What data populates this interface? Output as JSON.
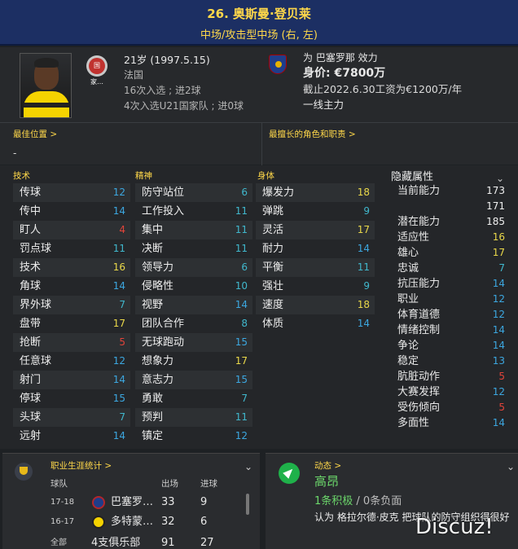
{
  "header": {
    "name": "26. 奥斯曼·登贝莱",
    "position": "中场/攻击型中场 (右, 左)"
  },
  "profile": {
    "nation_badge": "国家…",
    "age_line": "21岁 (1997.5.15)",
    "nation": "法国",
    "caps": "16次入选 ; 进2球",
    "u21_caps": "4次入选U21国家队 ; 进0球"
  },
  "contract": {
    "club_line": "为 巴塞罗那 效力",
    "value_line": "身价: €7800万",
    "expiry_line": "截止2022.6.30工资为€1200万/年",
    "status": "一线主力"
  },
  "best": {
    "best_position_label": "最佳位置 >",
    "best_position_value": "-",
    "best_role_label": "最擅长的角色和职责 >"
  },
  "technical": {
    "title": "技术",
    "items": [
      {
        "name": "传球",
        "value": "12"
      },
      {
        "name": "传中",
        "value": "14"
      },
      {
        "name": "盯人",
        "value": "4"
      },
      {
        "name": "罚点球",
        "value": "11"
      },
      {
        "name": "技术",
        "value": "16"
      },
      {
        "name": "角球",
        "value": "14"
      },
      {
        "name": "界外球",
        "value": "7"
      },
      {
        "name": "盘带",
        "value": "17"
      },
      {
        "name": "抢断",
        "value": "5"
      },
      {
        "name": "任意球",
        "value": "12"
      },
      {
        "name": "射门",
        "value": "14"
      },
      {
        "name": "停球",
        "value": "15"
      },
      {
        "name": "头球",
        "value": "7"
      },
      {
        "name": "远射",
        "value": "14"
      }
    ]
  },
  "mental": {
    "title": "精神",
    "items": [
      {
        "name": "防守站位",
        "value": "6"
      },
      {
        "name": "工作投入",
        "value": "11"
      },
      {
        "name": "集中",
        "value": "11"
      },
      {
        "name": "决断",
        "value": "11"
      },
      {
        "name": "领导力",
        "value": "6"
      },
      {
        "name": "侵略性",
        "value": "10"
      },
      {
        "name": "视野",
        "value": "14"
      },
      {
        "name": "团队合作",
        "value": "8"
      },
      {
        "name": "无球跑动",
        "value": "15"
      },
      {
        "name": "想象力",
        "value": "17"
      },
      {
        "name": "意志力",
        "value": "15"
      },
      {
        "name": "勇敢",
        "value": "7"
      },
      {
        "name": "预判",
        "value": "11"
      },
      {
        "name": "镇定",
        "value": "12"
      }
    ]
  },
  "physical": {
    "title": "身体",
    "items": [
      {
        "name": "爆发力",
        "value": "18"
      },
      {
        "name": "弹跳",
        "value": "9"
      },
      {
        "name": "灵活",
        "value": "17"
      },
      {
        "name": "耐力",
        "value": "14"
      },
      {
        "name": "平衡",
        "value": "11"
      },
      {
        "name": "强壮",
        "value": "9"
      },
      {
        "name": "速度",
        "value": "18"
      },
      {
        "name": "体质",
        "value": "14"
      }
    ]
  },
  "hidden": {
    "title": "隐藏属性",
    "items": [
      {
        "name": "当前能力",
        "value": "173"
      },
      {
        "name": "",
        "value": "171"
      },
      {
        "name": "潜在能力",
        "value": "185"
      },
      {
        "name": "适应性",
        "value": "16"
      },
      {
        "name": "雄心",
        "value": "17"
      },
      {
        "name": "忠诚",
        "value": "7"
      },
      {
        "name": "抗压能力",
        "value": "14"
      },
      {
        "name": "职业",
        "value": "12"
      },
      {
        "name": "体育道德",
        "value": "12"
      },
      {
        "name": "情绪控制",
        "value": "14"
      },
      {
        "name": "争论",
        "value": "14"
      },
      {
        "name": "稳定",
        "value": "13"
      },
      {
        "name": "肮脏动作",
        "value": "5"
      },
      {
        "name": "大赛发挥",
        "value": "12"
      },
      {
        "name": "受伤倾向",
        "value": "5"
      },
      {
        "name": "多面性",
        "value": "14"
      }
    ]
  },
  "career": {
    "title": "职业生涯统计 >",
    "col_club": "球队",
    "col_apps": "出场",
    "col_goals": "进球",
    "rows": [
      {
        "season": "17-18",
        "club": "巴塞罗…",
        "apps": "33",
        "goals": "9"
      },
      {
        "season": "16-17",
        "club": "多特蒙…",
        "apps": "32",
        "goals": "6"
      },
      {
        "season": "全部",
        "club": "4支俱乐部",
        "apps": "91",
        "goals": "27"
      }
    ]
  },
  "dynamics": {
    "title": "动态 >",
    "status": "高昂",
    "positive": "1条积极",
    "negative": " / 0条负面",
    "message": "认为 格拉尔德·皮克 把球队的防守组织得很好"
  },
  "watermark": "Discuz!",
  "colors": {
    "header_bg": "#1c2f63",
    "accent_label": "#ffd84a"
  }
}
